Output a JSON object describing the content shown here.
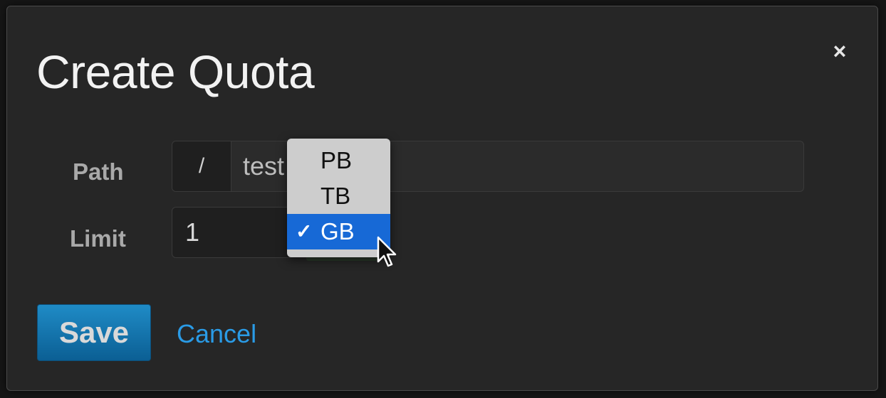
{
  "dialog": {
    "title": "Create Quota",
    "close_symbol": "×"
  },
  "form": {
    "path_label": "Path",
    "path_prefix": "/",
    "path_value": "test",
    "limit_label": "Limit",
    "limit_value": "1",
    "unit_options": [
      {
        "label": "PB",
        "selected": false
      },
      {
        "label": "TB",
        "selected": false
      },
      {
        "label": "GB",
        "selected": true
      }
    ],
    "checkmark": "✓"
  },
  "actions": {
    "save_label": "Save",
    "cancel_label": "Cancel"
  },
  "colors": {
    "primary_button": "#1f8bc6",
    "link": "#2a9be6",
    "selected_option": "#1769d6"
  },
  "icons": [
    "close-icon",
    "check-icon",
    "mouse-cursor-icon"
  ]
}
